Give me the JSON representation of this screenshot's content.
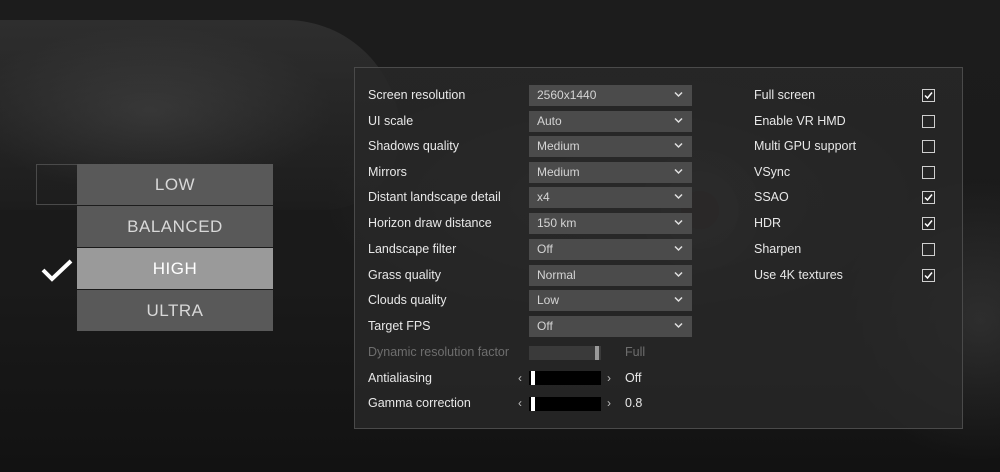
{
  "presets": {
    "items": [
      {
        "label": "LOW"
      },
      {
        "label": "BALANCED"
      },
      {
        "label": "HIGH"
      },
      {
        "label": "ULTRA"
      }
    ],
    "selected": "HIGH"
  },
  "settings": {
    "dropdowns": [
      {
        "label": "Screen resolution",
        "value": "2560x1440"
      },
      {
        "label": "UI scale",
        "value": "Auto"
      },
      {
        "label": "Shadows quality",
        "value": "Medium"
      },
      {
        "label": "Mirrors",
        "value": "Medium"
      },
      {
        "label": "Distant landscape detail",
        "value": "x4"
      },
      {
        "label": "Horizon draw distance",
        "value": "150 km"
      },
      {
        "label": "Landscape filter",
        "value": "Off"
      },
      {
        "label": "Grass quality",
        "value": "Normal"
      },
      {
        "label": "Clouds quality",
        "value": "Low"
      },
      {
        "label": "Target FPS",
        "value": "Off"
      }
    ],
    "sliders": [
      {
        "label": "Dynamic resolution factor",
        "value": "Full",
        "enabled": false
      },
      {
        "label": "Antialiasing",
        "value": "Off",
        "enabled": true
      },
      {
        "label": "Gamma correction",
        "value": "0.8",
        "enabled": true
      }
    ],
    "toggles": [
      {
        "label": "Full screen",
        "checked": true
      },
      {
        "label": "Enable VR HMD",
        "checked": false
      },
      {
        "label": "Multi GPU support",
        "checked": false
      },
      {
        "label": "VSync",
        "checked": false
      },
      {
        "label": "SSAO",
        "checked": true
      },
      {
        "label": "HDR",
        "checked": true
      },
      {
        "label": "Sharpen",
        "checked": false
      },
      {
        "label": "Use 4K textures",
        "checked": true
      }
    ]
  },
  "icons": {
    "dropdown": "chevron-down-icon",
    "slider_left": "arrow-left-icon",
    "slider_right": "arrow-right-icon",
    "selected_preset": "checkmark-icon"
  }
}
